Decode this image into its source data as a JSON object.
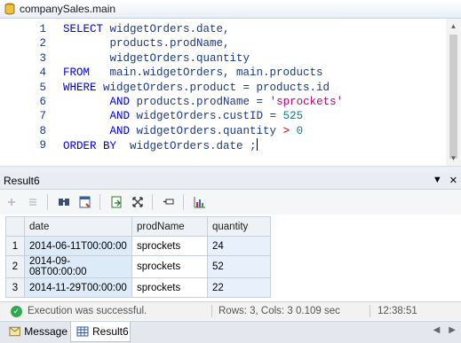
{
  "window": {
    "title": "companySales.main",
    "icon": "database-icon"
  },
  "editor": {
    "lines": [
      {
        "n": "1",
        "parts": [
          [
            "kw",
            "SELECT "
          ],
          [
            "tx",
            "widgetOrders.date,"
          ]
        ]
      },
      {
        "n": "2",
        "parts": [
          [
            "tx",
            "       products.prodName,"
          ]
        ]
      },
      {
        "n": "3",
        "parts": [
          [
            "tx",
            "       widgetOrders.quantity"
          ]
        ]
      },
      {
        "n": "4",
        "parts": [
          [
            "kw",
            "FROM   "
          ],
          [
            "tx",
            "main.widgetOrders, main.products"
          ]
        ]
      },
      {
        "n": "5",
        "parts": [
          [
            "kw",
            "WHERE "
          ],
          [
            "tx",
            "widgetOrders.product = products.id"
          ]
        ]
      },
      {
        "n": "6",
        "parts": [
          [
            "tx",
            "       "
          ],
          [
            "kw",
            "AND "
          ],
          [
            "tx",
            "products.prodName = "
          ],
          [
            "str",
            "'sprockets'"
          ]
        ]
      },
      {
        "n": "7",
        "parts": [
          [
            "tx",
            "       "
          ],
          [
            "kw",
            "AND "
          ],
          [
            "tx",
            "widgetOrders.custID = "
          ],
          [
            "num",
            "525"
          ]
        ]
      },
      {
        "n": "8",
        "parts": [
          [
            "tx",
            "       "
          ],
          [
            "kw",
            "AND "
          ],
          [
            "tx",
            "widgetOrders.quantity "
          ],
          [
            "op",
            "> "
          ],
          [
            "num",
            "0"
          ]
        ]
      },
      {
        "n": "9",
        "parts": [
          [
            "kw",
            "ORDER BY  "
          ],
          [
            "tx",
            "widgetOrders.date ;"
          ]
        ]
      }
    ]
  },
  "result": {
    "title": "Result6",
    "pin_label": "▼",
    "close_label": "✕",
    "columns": [
      "date",
      "prodName",
      "quantity"
    ],
    "rows": [
      {
        "n": "1",
        "cells": [
          "2014-06-11T00:00:00",
          "sprockets",
          "24"
        ]
      },
      {
        "n": "2",
        "cells": [
          "2014-09-08T00:00:00",
          "sprockets",
          "52"
        ]
      },
      {
        "n": "3",
        "cells": [
          "2014-11-29T00:00:00",
          "sprockets",
          "22"
        ]
      }
    ]
  },
  "toolbar": {
    "buttons": [
      "insert-row-icon",
      "remove-row-icon",
      "find-icon",
      "commit-icon",
      "export-icon",
      "fullscreen-icon",
      "pin-icon",
      "chart-icon"
    ]
  },
  "status": {
    "message": "Execution was successful.",
    "rows_cols": "Rows: 3, Cols: 3",
    "elapsed": "0.109 sec",
    "clock": "12:38:51"
  },
  "tabs": [
    {
      "label": "Message",
      "icon": "message-icon",
      "active": false
    },
    {
      "label": "Result6",
      "icon": "grid-icon",
      "active": true
    }
  ],
  "colors": {
    "keyword": "#0000e0",
    "text": "#1c3a80",
    "string": "#c0007a",
    "number": "#00838f",
    "operator": "#d00000",
    "success": "#2fa84f"
  }
}
